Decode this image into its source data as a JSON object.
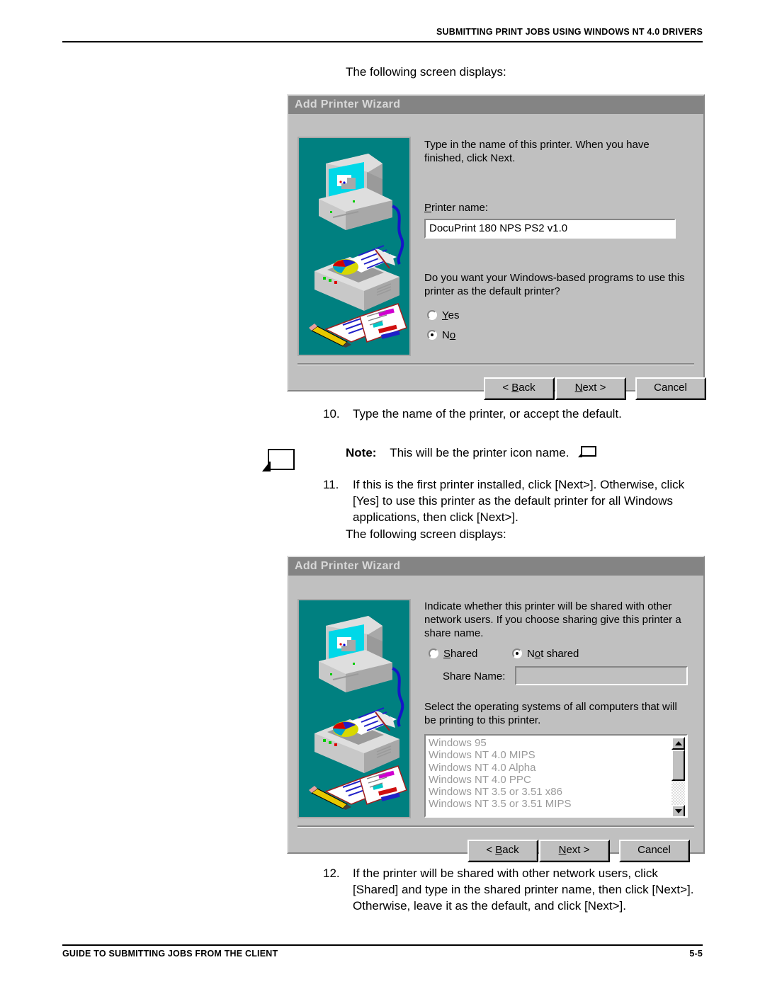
{
  "page": {
    "header": "SUBMITTING PRINT JOBS USING WINDOWS NT 4.0 DRIVERS",
    "footer_left": "GUIDE TO SUBMITTING JOBS FROM THE CLIENT",
    "footer_page": "5-5"
  },
  "intro1": "The following screen displays:",
  "intro2": "The following screen displays:",
  "steps": [
    {
      "number": "10.",
      "text": "Type the name of the printer, or accept the default."
    },
    {
      "number": "11.",
      "text": "If this is the first printer installed, click [Next>]. Otherwise, click [Yes] to use this printer as the default printer for all Windows applications, then click [Next>]."
    },
    {
      "number": "12.",
      "text": "If the printer will be shared with other network users, click [Shared] and type in the shared printer name, then click [Next>]. Otherwise, leave it as the default, and click [Next>]."
    }
  ],
  "note": {
    "label": "Note:",
    "text": "This will be the printer icon name."
  },
  "dialog1": {
    "title": "Add Printer Wizard",
    "instruction": "Type in the name of this printer.  When you have finished, click Next.",
    "printer_name_label": "Printer name:",
    "printer_name_value": "DocuPrint 180 NPS PS2 v1.0",
    "default_question": "Do you want your Windows-based programs to use this printer as the default printer?",
    "radio_yes": "Yes",
    "radio_no": "No",
    "selected_radio": "No",
    "buttons": {
      "back": "< Back",
      "next": "Next >",
      "cancel": "Cancel"
    }
  },
  "dialog2": {
    "title": "Add Printer Wizard",
    "instruction": "Indicate whether this printer will be shared with other network users.  If you choose sharing give this printer a share name.",
    "radio_shared": "Shared",
    "radio_not_shared": "Not shared",
    "selected_radio": "Not shared",
    "share_name_label": "Share Name:",
    "share_name_value": "",
    "os_instruction": "Select the operating systems of all computers that will be printing to this printer.",
    "os_list": [
      "Windows 95",
      "Windows NT 4.0 MIPS",
      "Windows NT 4.0 Alpha",
      "Windows NT 4.0 PPC",
      "Windows NT 3.5 or 3.51 x86",
      "Windows NT 3.5 or 3.51 MIPS"
    ],
    "buttons": {
      "back": "< Back",
      "next": "Next >",
      "cancel": "Cancel"
    }
  },
  "colors": {
    "dialog_face": "#c0c0c0",
    "title_bar": "#848484",
    "illustration_bg": "#008080",
    "field_bg": "#ffffff",
    "disabled_text": "#9a9a9a"
  }
}
